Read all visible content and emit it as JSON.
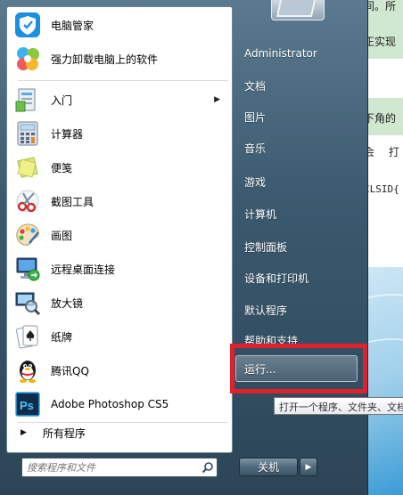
{
  "background_doc": {
    "lines": [
      "间。所",
      "正实现",
      "下角的",
      "会 打",
      "CLSID{",
      "“"
    ]
  },
  "left_menu": {
    "pinned": [
      {
        "label": "电脑管家",
        "icon": "shield-icon"
      },
      {
        "label": "强力卸载电脑上的软件",
        "icon": "clover-icon"
      }
    ],
    "recent": [
      {
        "label": "入门",
        "icon": "getting-started-icon",
        "has_submenu": true
      },
      {
        "label": "计算器",
        "icon": "calculator-icon"
      },
      {
        "label": "便笺",
        "icon": "sticky-notes-icon"
      },
      {
        "label": "截图工具",
        "icon": "scissors-icon"
      },
      {
        "label": "画图",
        "icon": "paint-palette-icon"
      },
      {
        "label": "远程桌面连接",
        "icon": "remote-desktop-icon"
      },
      {
        "label": "放大镜",
        "icon": "magnifier-icon"
      },
      {
        "label": "纸牌",
        "icon": "playing-cards-icon"
      },
      {
        "label": "腾讯QQ",
        "icon": "qq-penguin-icon"
      },
      {
        "label": "Adobe Photoshop CS5",
        "icon": "photoshop-icon"
      }
    ],
    "all_programs": "所有程序",
    "search_placeholder": "搜索程序和文件"
  },
  "right_menu": {
    "items": [
      "Administrator",
      "文档",
      "图片",
      "音乐",
      "游戏",
      "计算机",
      "控制面板",
      "设备和打印机",
      "默认程序",
      "帮助和支持"
    ],
    "run": "运行...",
    "tooltip": "打开一个程序、文件夹、文档",
    "shutdown": "关机"
  },
  "colors": {
    "highlight_box": "#e0202a"
  }
}
